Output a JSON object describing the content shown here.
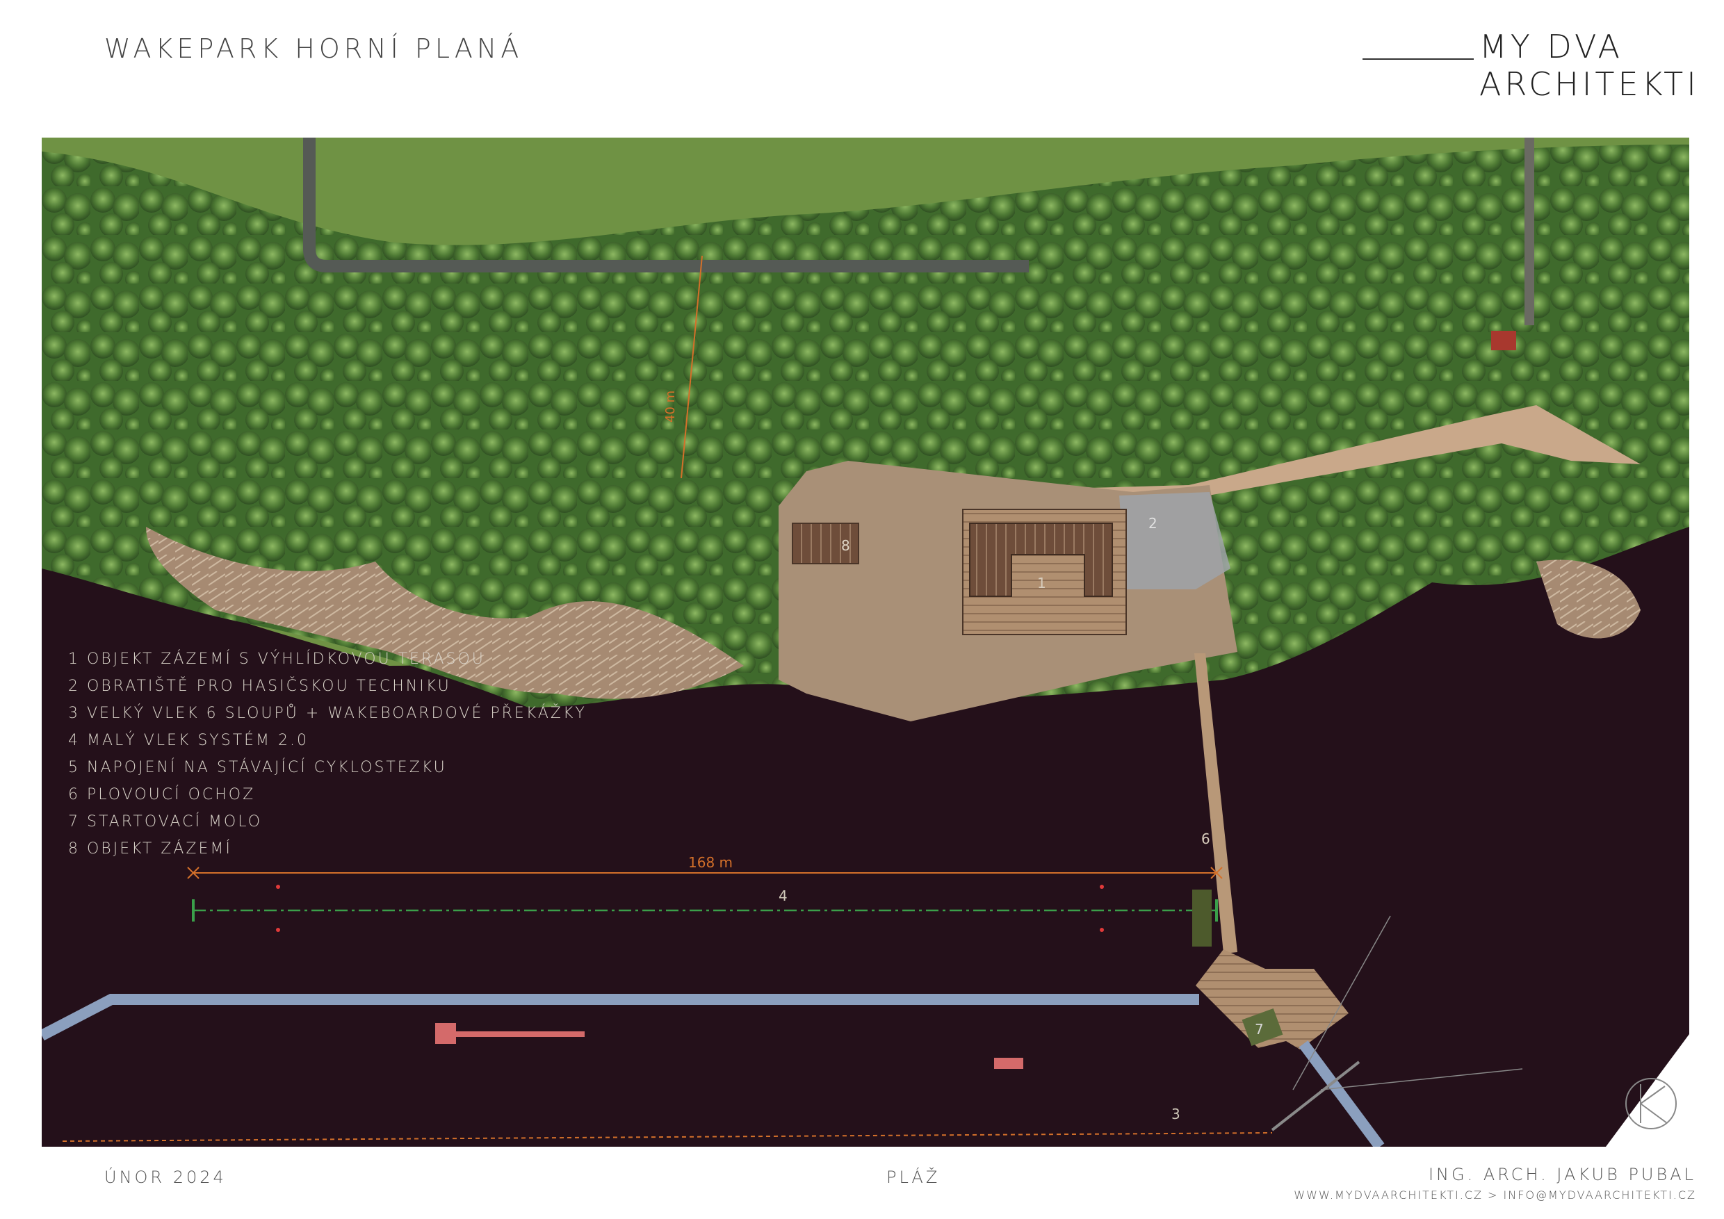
{
  "header": {
    "title": "WAKEPARK HORNÍ PLANÁ",
    "logo": "MY DVA ARCHITEKTI"
  },
  "legend": [
    "1 OBJEKT ZÁZEMÍ S VÝHLÍDKOVOU TERASOU",
    "2 OBRATIŠTĚ PRO HASIČSKOU TECHNIKU",
    "3 VELKÝ VLEK 6 SLOUPŮ + WAKEBOARDOVÉ PŘEKÁŽKY",
    "4 MALÝ VLEK SYSTÉM 2.0",
    "5 NAPOJENÍ NA STÁVAJÍCÍ CYKLOSTEZKU",
    "6 PLOVOUCÍ OCHOZ",
    "7 STARTOVACÍ MOLO",
    "8  OBJEKT ZÁZEMÍ"
  ],
  "map_labels": {
    "dimension": "168 m",
    "distance": "40 m",
    "n1": "1",
    "n2": "2",
    "n3": "3",
    "n4": "4",
    "n6": "6",
    "n7": "7",
    "n8": "8"
  },
  "footer": {
    "date": "ÚNOR 2024",
    "sheet": "PLÁŽ",
    "author": "ING. ARCH. JAKUB PUBAL",
    "web": "WWW.MYDVAARCHITEKTI.CZ > INFO@MYDVAARCHITEKTI.CZ"
  },
  "colors": {
    "water": "#24101a",
    "forest": "#4f7a34",
    "meadow": "#6f9244",
    "beach": "#a99077",
    "deck": "#6e4d3a",
    "cableway": "#8b9fbe",
    "dimension": "#d4702a",
    "small_cable": "#3aa04a"
  }
}
